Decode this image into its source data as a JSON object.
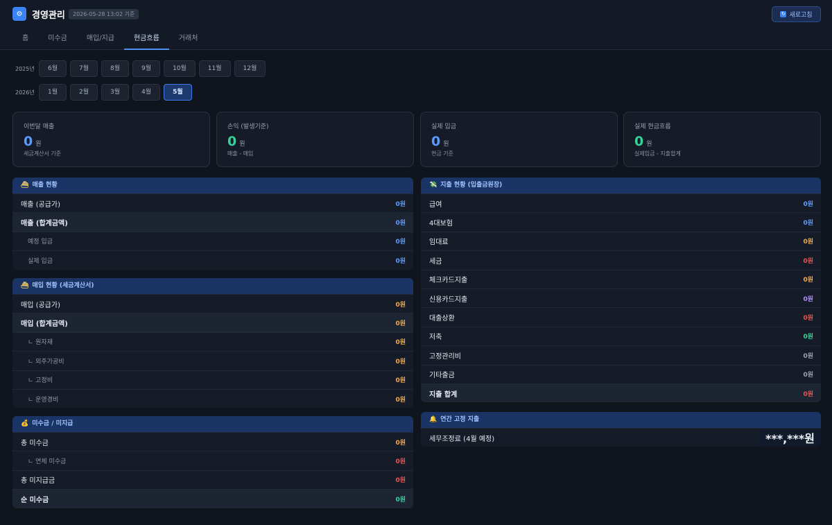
{
  "header": {
    "title": "경영관리",
    "timestamp": "2026-05-28 13:02 기준",
    "refresh_label": "새로고침",
    "logo_icon": "gear-icon",
    "accent": "#3b82f6"
  },
  "tabs": [
    "홈",
    "미수금",
    "매입/지급",
    "현금흐름",
    "거래처"
  ],
  "active_tab": "현금흐름",
  "periods": {
    "y2025": {
      "label": "2025년",
      "months": [
        "6월",
        "7월",
        "8월",
        "9월",
        "10월",
        "11월",
        "12월"
      ]
    },
    "y2026": {
      "label": "2026년",
      "months": [
        "1월",
        "2월",
        "3월",
        "4월",
        "5월"
      ]
    },
    "selected": "5월"
  },
  "kpis": [
    {
      "title": "이번달 매출",
      "value": "0",
      "unit": "원",
      "sub": "세금계산서 기준",
      "color": "#5b9bff"
    },
    {
      "title": "손익 (발생기준)",
      "value": "0",
      "unit": "원",
      "sub": "매출 - 매입",
      "color": "#34d399"
    },
    {
      "title": "실제 입금",
      "value": "0",
      "unit": "원",
      "sub": "현금 기준",
      "color": "#5b9bff"
    },
    {
      "title": "실제 현금흐름",
      "value": "0",
      "unit": "원",
      "sub": "실제입금 - 지출합계",
      "color": "#34d399"
    }
  ],
  "sales": {
    "title": "매출 현황",
    "icon": "ship-icon",
    "rows": [
      {
        "label": "매출 (공급가)",
        "value": "0원"
      },
      {
        "label": "매출 (합계금액)",
        "value": "0원"
      },
      {
        "label": "예정 입금",
        "value": "0원"
      },
      {
        "label": "실제 입금",
        "value": "0원"
      }
    ]
  },
  "purchase": {
    "title": "매입 현황 (세금계산서)",
    "icon": "ship-icon",
    "rows": [
      {
        "label": "매입 (공급가)",
        "value": "0원"
      },
      {
        "label": "매입 (합계금액)",
        "value": "0원"
      },
      {
        "label": "ㄴ 원자재",
        "value": "0원"
      },
      {
        "label": "ㄴ 외주가공비",
        "value": "0원"
      },
      {
        "label": "ㄴ 고정비",
        "value": "0원"
      },
      {
        "label": "ㄴ 운영경비",
        "value": "0원"
      }
    ]
  },
  "receivables": {
    "title": "미수금 / 미지급",
    "icon": "money-bag-icon",
    "rows": [
      {
        "label": "총 미수금",
        "value": "0원"
      },
      {
        "label": "ㄴ 연체 미수금",
        "value": "0원"
      },
      {
        "label": "총 미지급금",
        "value": "0원"
      },
      {
        "label": "순 미수금",
        "value": "0원"
      }
    ]
  },
  "expense": {
    "title": "지출 현황 (입출금원장)",
    "icon": "flying-money-icon",
    "rows": [
      {
        "label": "급여",
        "value": "0원"
      },
      {
        "label": "4대보험",
        "value": "0원"
      },
      {
        "label": "임대료",
        "value": "0원"
      },
      {
        "label": "세금",
        "value": "0원"
      },
      {
        "label": "체크카드지출",
        "value": "0원"
      },
      {
        "label": "신용카드지출",
        "value": "0원"
      },
      {
        "label": "대출상환",
        "value": "0원"
      },
      {
        "label": "저축",
        "value": "0원"
      },
      {
        "label": "고정관리비",
        "value": "0원"
      },
      {
        "label": "기타출금",
        "value": "0원"
      },
      {
        "label": "지출 합계",
        "value": "0원"
      }
    ]
  },
  "annual": {
    "title": "연간 고정 지출",
    "icon": "bell-icon",
    "label": "세무조정료 (4월 예정)",
    "value": "***,***원"
  }
}
